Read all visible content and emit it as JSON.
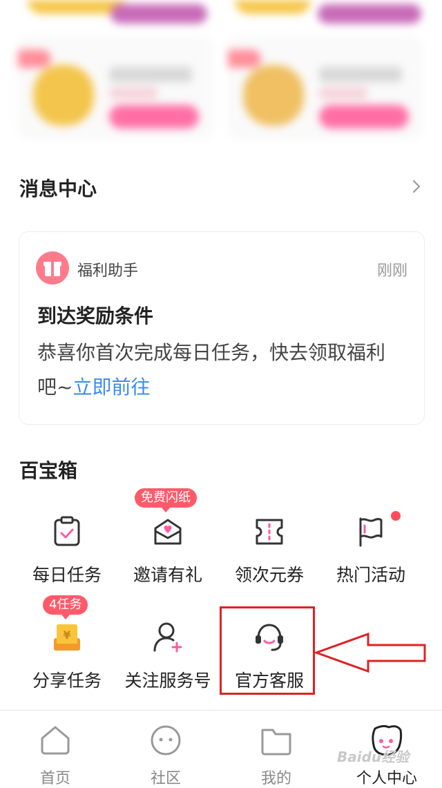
{
  "message_center": {
    "title": "消息中心",
    "card": {
      "sender": "福利助手",
      "time": "刚刚",
      "title": "到达奖励条件",
      "body": "恭喜你首次完成每日任务，快去领取福利吧~",
      "link": "立即前往"
    }
  },
  "toolbox": {
    "title": "百宝箱",
    "items": [
      {
        "label": "每日任务",
        "icon": "clipboard-check-icon"
      },
      {
        "label": "邀请有礼",
        "icon": "envelope-heart-icon",
        "badge": "免费闪纸"
      },
      {
        "label": "领次元券",
        "icon": "ticket-icon"
      },
      {
        "label": "热门活动",
        "icon": "flag-icon",
        "dot": true
      },
      {
        "label": "分享任务",
        "icon": "coin-box-icon",
        "badge": "4任务"
      },
      {
        "label": "关注服务号",
        "icon": "user-add-icon"
      },
      {
        "label": "官方客服",
        "icon": "headset-icon"
      }
    ]
  },
  "tabbar": {
    "items": [
      {
        "label": "首页",
        "icon": "home-icon"
      },
      {
        "label": "社区",
        "icon": "chat-face-icon"
      },
      {
        "label": "我的",
        "icon": "folder-icon"
      },
      {
        "label": "个人中心",
        "icon": "avatar-icon",
        "active": true
      }
    ]
  },
  "watermark": "Baidu经验",
  "colors": {
    "accent": "#ff5a6a",
    "link": "#3d8bf2",
    "highlight": "#e02020"
  }
}
